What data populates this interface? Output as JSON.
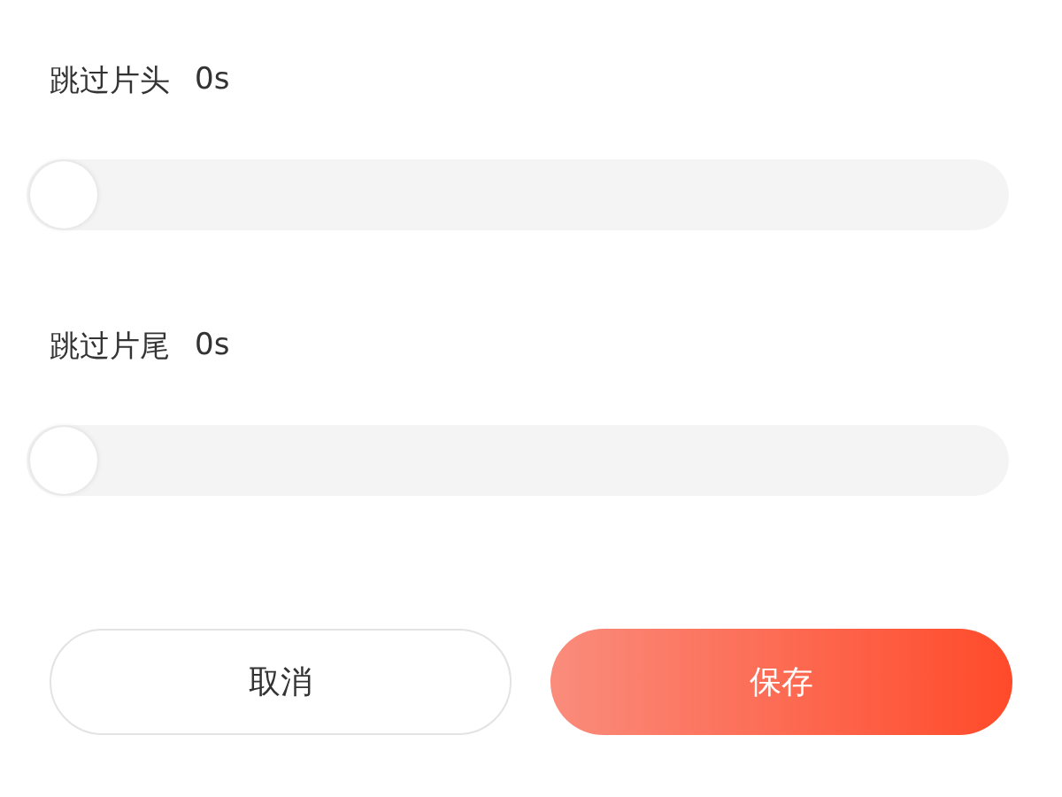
{
  "settings": [
    {
      "label": "跳过片头",
      "value": "0s",
      "level": 0
    },
    {
      "label": "跳过片尾",
      "value": "0s",
      "level": 0
    }
  ],
  "buttons": [
    {
      "label": "取消",
      "kind": "secondary"
    },
    {
      "label": "保存",
      "kind": "primary"
    }
  ]
}
